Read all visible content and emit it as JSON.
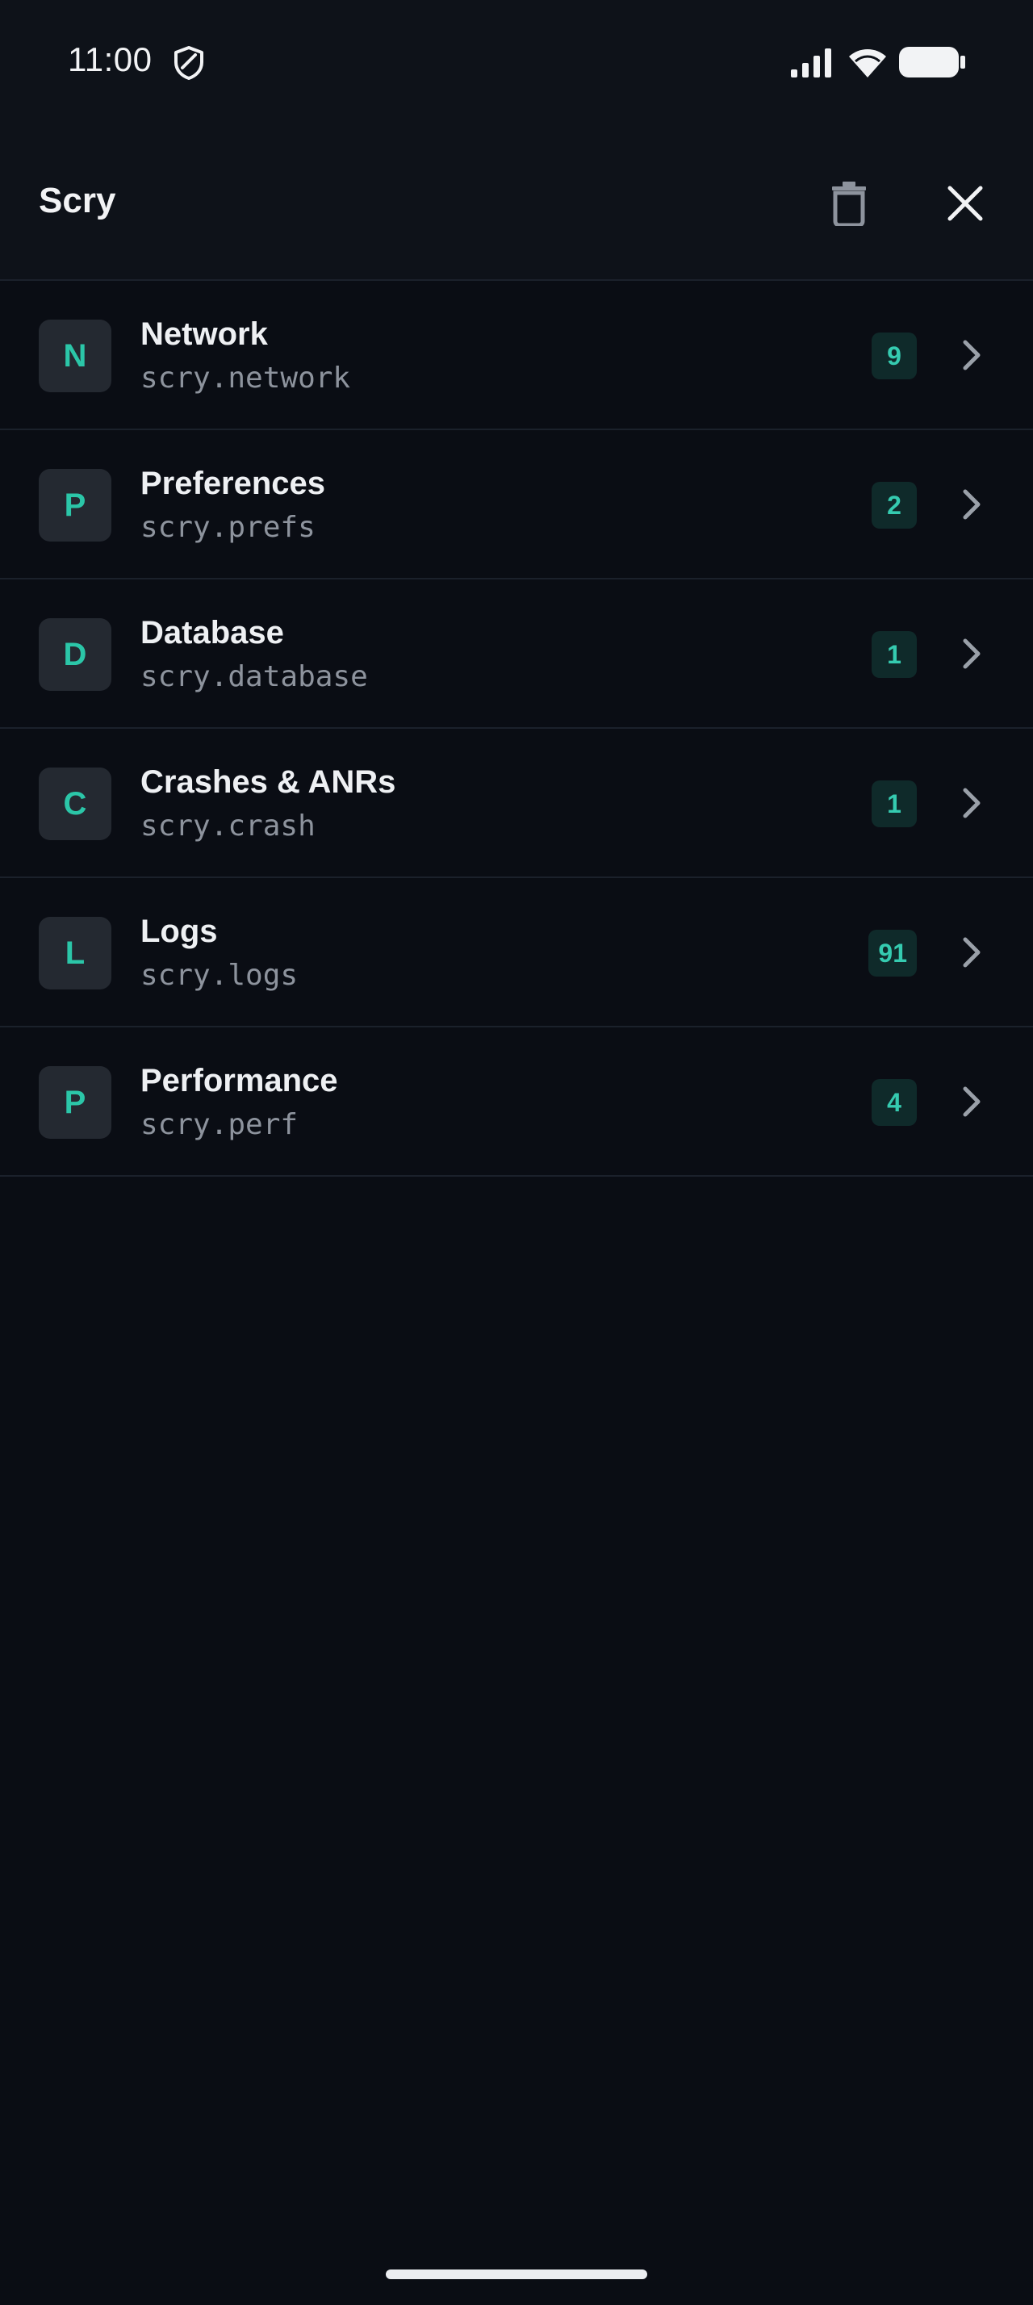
{
  "status_bar": {
    "time": "11:00",
    "icons": [
      "shield-icon",
      "cell-signal-icon",
      "wifi-icon",
      "battery-icon"
    ]
  },
  "app_bar": {
    "title": "Scry",
    "actions": [
      "trash-icon",
      "close-icon"
    ]
  },
  "colors": {
    "background": "#0a0d14",
    "surface": "#0e1219",
    "accent": "#2bc6a8",
    "badge_bg": "#0f2a2a",
    "divider": "#1b212b"
  },
  "modules": [
    {
      "letter": "N",
      "title": "Network",
      "id": "scry.network",
      "count": "9"
    },
    {
      "letter": "P",
      "title": "Preferences",
      "id": "scry.prefs",
      "count": "2"
    },
    {
      "letter": "D",
      "title": "Database",
      "id": "scry.database",
      "count": "1"
    },
    {
      "letter": "C",
      "title": "Crashes & ANRs",
      "id": "scry.crash",
      "count": "1"
    },
    {
      "letter": "L",
      "title": "Logs",
      "id": "scry.logs",
      "count": "91"
    },
    {
      "letter": "P",
      "title": "Performance",
      "id": "scry.perf",
      "count": "4"
    }
  ]
}
